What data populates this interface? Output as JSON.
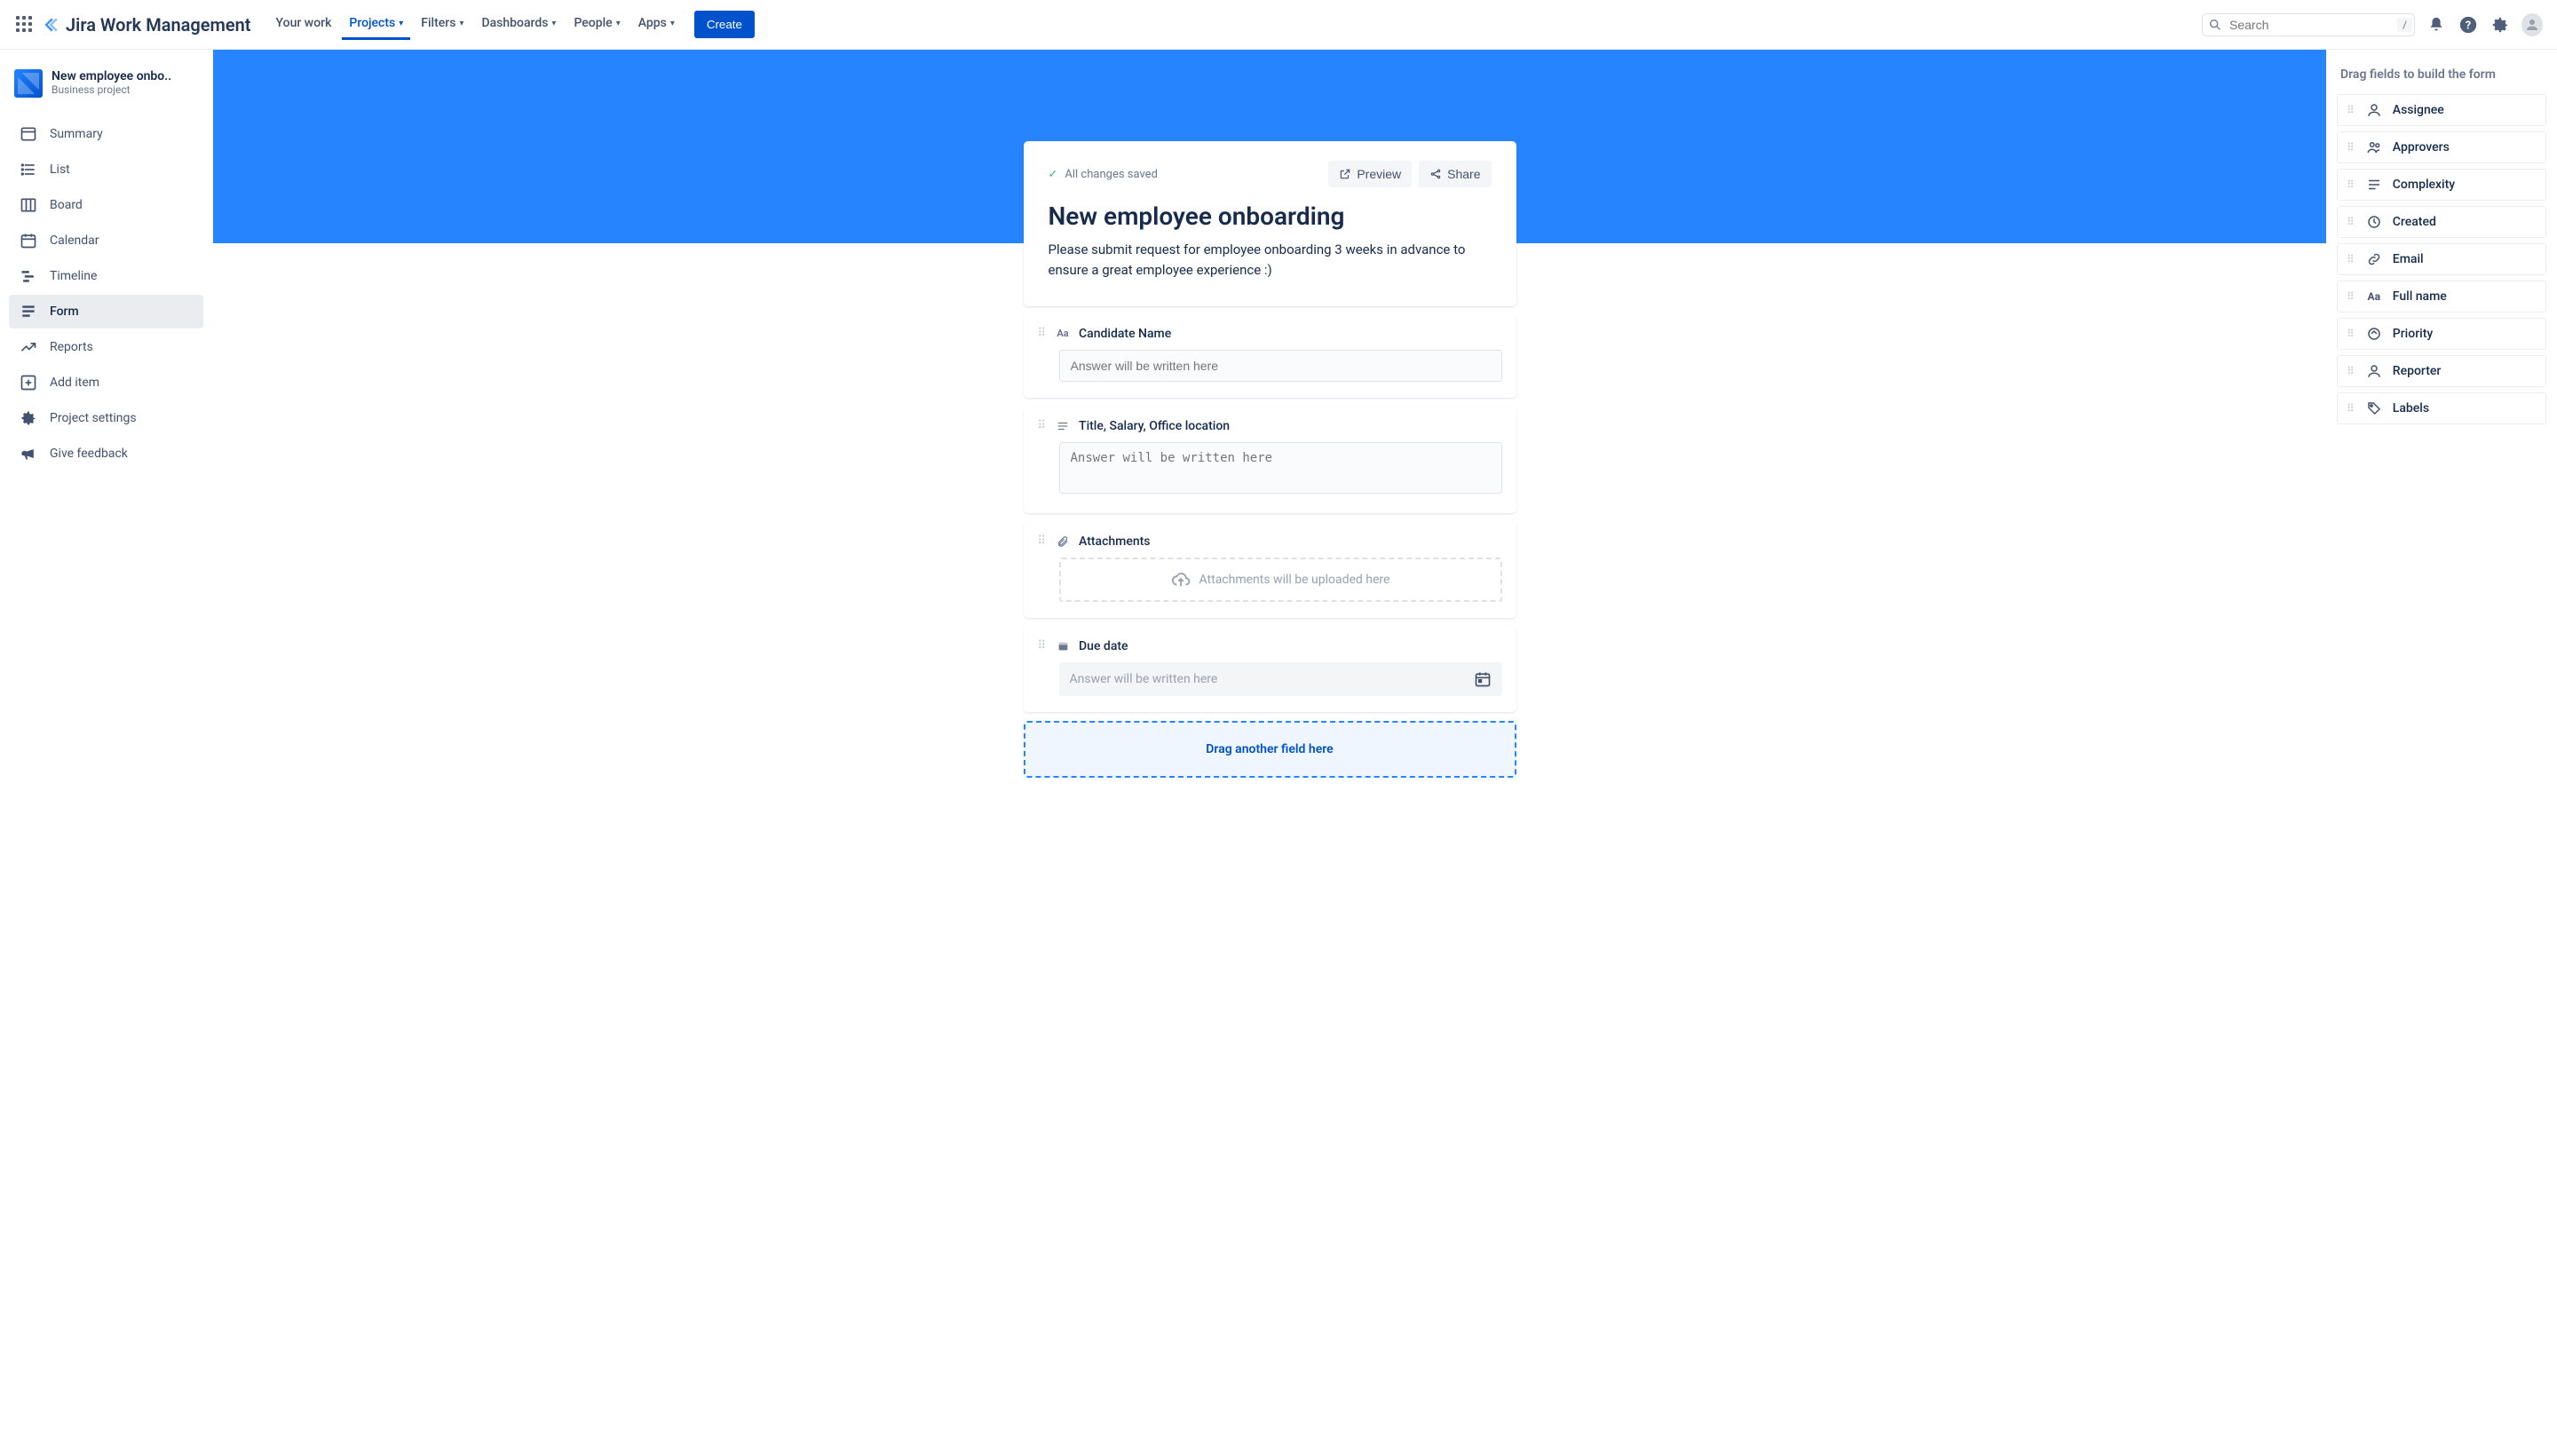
{
  "brand": "Jira Work Management",
  "topnav": {
    "items": [
      "Your work",
      "Projects",
      "Filters",
      "Dashboards",
      "People",
      "Apps"
    ],
    "active_index": 1,
    "create": "Create",
    "search_placeholder": "Search",
    "search_kbd": "/"
  },
  "project": {
    "name": "New employee onbo..",
    "type": "Business project"
  },
  "sidebar": {
    "items": [
      "Summary",
      "List",
      "Board",
      "Calendar",
      "Timeline",
      "Form",
      "Reports",
      "Add item",
      "Project settings",
      "Give feedback"
    ],
    "active_index": 5
  },
  "form": {
    "saved_text": "All changes saved",
    "preview": "Preview",
    "share": "Share",
    "title": "New employee onboarding",
    "description": "Please submit request for employee onboarding 3 weeks in advance to ensure a great employee experience :)",
    "answer_placeholder": "Answer will be written here",
    "attach_placeholder": "Attachments will be uploaded here",
    "drop_label": "Drag another field here",
    "fields": [
      {
        "label": "Candidate Name",
        "type": "short-text"
      },
      {
        "label": "Title, Salary, Office location",
        "type": "paragraph"
      },
      {
        "label": "Attachments",
        "type": "attachment"
      },
      {
        "label": "Due date",
        "type": "date"
      }
    ]
  },
  "right_panel": {
    "title": "Drag fields to build the form",
    "fields": [
      "Assignee",
      "Approvers",
      "Complexity",
      "Created",
      "Email",
      "Full name",
      "Priority",
      "Reporter",
      "Labels"
    ]
  }
}
